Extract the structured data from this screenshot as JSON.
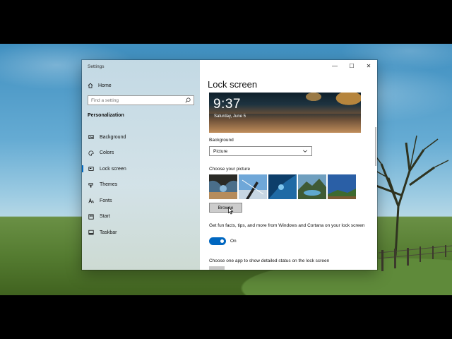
{
  "app": {
    "title": "Settings"
  },
  "sidebar": {
    "home_label": "Home",
    "search_placeholder": "Find a setting",
    "section_title": "Personalization",
    "items": [
      {
        "label": "Background",
        "icon": "image-icon"
      },
      {
        "label": "Colors",
        "icon": "palette-icon"
      },
      {
        "label": "Lock screen",
        "icon": "lock-screen-icon",
        "active": true
      },
      {
        "label": "Themes",
        "icon": "brush-icon"
      },
      {
        "label": "Fonts",
        "icon": "font-icon"
      },
      {
        "label": "Start",
        "icon": "start-icon"
      },
      {
        "label": "Taskbar",
        "icon": "taskbar-icon"
      }
    ]
  },
  "window_controls": {
    "minimize": "—",
    "maximize": "☐",
    "close": "✕"
  },
  "main": {
    "title": "Lock screen",
    "preview": {
      "time": "9:37",
      "date": "Saturday, June 5"
    },
    "background_label": "Background",
    "background_value": "Picture",
    "choose_picture_label": "Choose your picture",
    "browse_label": "Browse",
    "fun_facts_text": "Get fun facts, tips, and more from Windows and Cortana on your lock screen",
    "toggle_label": "On",
    "toggle_on": true,
    "detailed_status_text": "Choose one app to show detailed status on the lock screen"
  },
  "colors": {
    "accent": "#0067c0"
  }
}
